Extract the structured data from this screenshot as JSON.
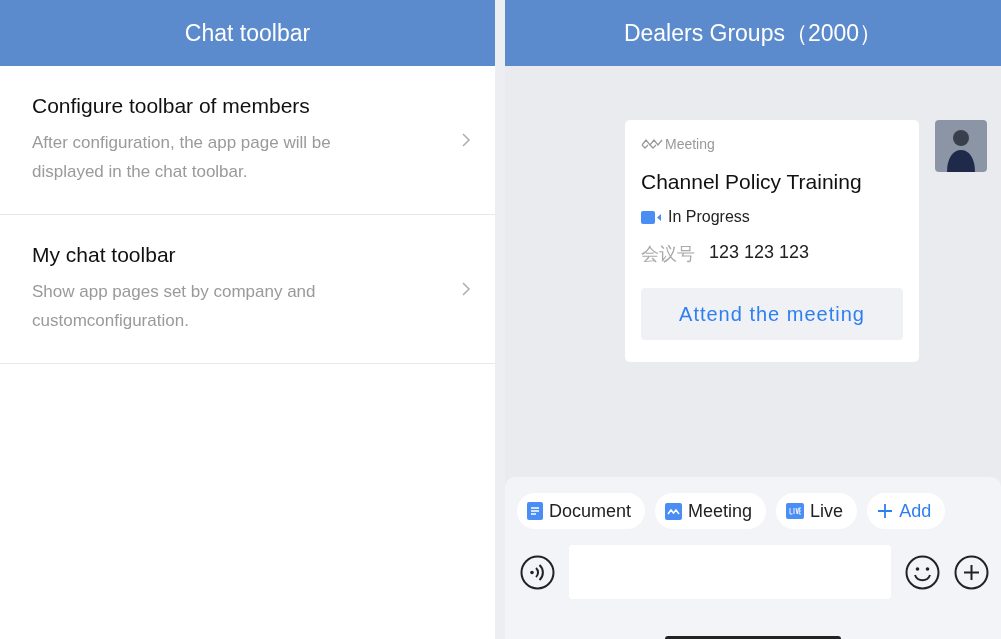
{
  "left": {
    "title": "Chat toolbar",
    "items": [
      {
        "title": "Configure toolbar of members",
        "description": "After configuration, the app page will be displayed in the chat toolbar."
      },
      {
        "title": "My chat toolbar",
        "description": "Show app pages set by company and customconfiguration."
      }
    ]
  },
  "right": {
    "title": "Dealers Groups（2000）",
    "card": {
      "app": "Meeting",
      "title": "Channel Policy Training",
      "status": "In Progress",
      "id_label": "会议号",
      "id_value": "123 123 123",
      "button": "Attend the meeting"
    },
    "toolbar": [
      {
        "kind": "document",
        "label": "Document"
      },
      {
        "kind": "meeting",
        "label": "Meeting"
      },
      {
        "kind": "live",
        "label": "Live"
      },
      {
        "kind": "add",
        "label": "Add"
      }
    ]
  }
}
